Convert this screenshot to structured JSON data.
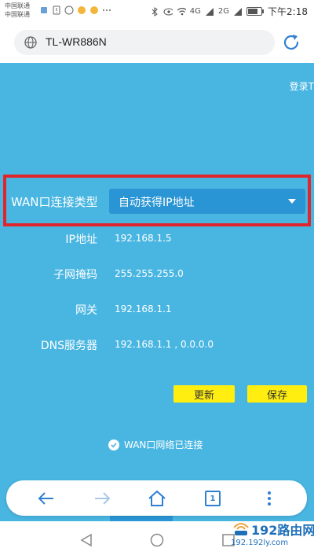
{
  "status_bar": {
    "carrier_1": "中国联通",
    "carrier_2": "中国联通",
    "signal_1": "4G",
    "signal_2": "2G",
    "time": "下午2:18"
  },
  "address_bar": {
    "url": "TL-WR886N"
  },
  "page": {
    "login_link": "登录T",
    "wan_type": {
      "label": "WAN口连接类型",
      "selected": "自动获得IP地址"
    },
    "fields": [
      {
        "label": "IP地址",
        "value": "192.168.1.5"
      },
      {
        "label": "子网掩码",
        "value": "255.255.255.0"
      },
      {
        "label": "网关",
        "value": "192.168.1.1"
      },
      {
        "label": "DNS服务器",
        "value": "192.168.1.1 , 0.0.0.0"
      }
    ],
    "buttons": {
      "refresh": "更新",
      "save": "保存"
    },
    "connection_status": "WAN口网络已连接"
  },
  "toolbar": {
    "tabs_count": "1"
  },
  "watermark": {
    "main": "192路由网",
    "sub": "192.192ly.com"
  },
  "colors": {
    "page_bg": "#49b6e2",
    "select_bg": "#2a95d4",
    "highlight_border": "#e0262b",
    "button_bg": "#ffee10",
    "toolbar_icon": "#2f7fd3"
  }
}
